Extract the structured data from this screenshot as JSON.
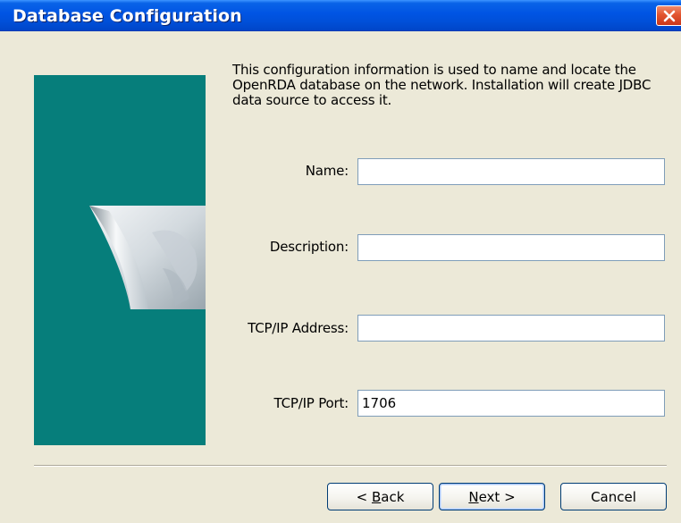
{
  "window": {
    "title": "Database Configuration",
    "close_icon": "close-icon"
  },
  "intro_text": "This configuration information is used to name and locate the OpenRDA database on the network. Installation will create JDBC data source to access it.",
  "side_panel": {
    "color": "#067E7B",
    "graphic_icon": "page-curl-graphic"
  },
  "fields": {
    "name": {
      "label": "Name:",
      "value": ""
    },
    "description": {
      "label": "Description:",
      "value": ""
    },
    "tcp_address": {
      "label": "TCP/IP Address:",
      "value": ""
    },
    "tcp_port": {
      "label": "TCP/IP Port:",
      "value": "1706"
    }
  },
  "buttons": {
    "back": {
      "prefix": "< ",
      "mnemonic": "B",
      "rest": "ack"
    },
    "next": {
      "mnemonic": "N",
      "rest": "ext >"
    },
    "cancel": {
      "label": "Cancel"
    }
  },
  "colors": {
    "titlebar": "#0054E3",
    "dialog_bg": "#ECE9D8",
    "close_button": "#E2552F"
  }
}
